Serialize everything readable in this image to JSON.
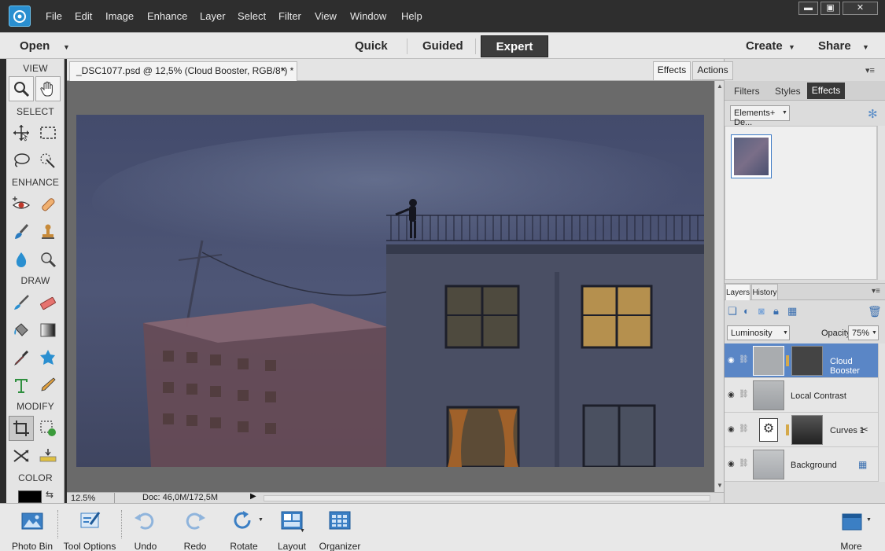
{
  "menubar": {
    "items": [
      "File",
      "Edit",
      "Image",
      "Enhance",
      "Layer",
      "Select",
      "Filter",
      "View",
      "Window",
      "Help"
    ],
    "window_controls": {
      "minimize": "▬",
      "maximize": "▣",
      "close": "✕"
    }
  },
  "modebar": {
    "open_label": "Open",
    "tabs": [
      "Quick",
      "Guided",
      "Expert"
    ],
    "active_tab": "Expert",
    "create_label": "Create",
    "share_label": "Share"
  },
  "toolbox": {
    "sections": [
      "VIEW",
      "SELECT",
      "ENHANCE",
      "DRAW",
      "MODIFY",
      "COLOR"
    ],
    "tools": {
      "view": [
        "zoom-icon",
        "hand-icon"
      ],
      "select": [
        "move-icon",
        "marquee-icon",
        "lasso-icon",
        "quick-selection-icon"
      ],
      "enhance": [
        "red-eye-icon",
        "spot-healing-icon",
        "smart-brush-icon",
        "clone-stamp-icon",
        "blur-icon",
        "sponge-icon"
      ],
      "draw": [
        "brush-icon",
        "eraser-icon",
        "paint-bucket-icon",
        "gradient-icon",
        "eyedropper-icon",
        "custom-shape-icon",
        "type-icon",
        "pencil-icon"
      ],
      "modify": [
        "crop-icon",
        "recompose-icon",
        "content-aware-move-icon",
        "straighten-icon"
      ]
    },
    "foreground_color": "#000000"
  },
  "document": {
    "tab_title": "_DSC1077.psd @ 12,5% (Cloud Booster, RGB/8*) *",
    "tab_close": "×",
    "zoom": "12.5%",
    "doc_size": "Doc: 46,0M/172,5M"
  },
  "right_panel": {
    "top_tabs": [
      "Effects",
      "Actions"
    ],
    "sub_tabs": [
      "Filters",
      "Styles",
      "Effects"
    ],
    "active_sub_tab": "Effects",
    "category_dropdown": "Elements+ De...",
    "layers_tabs": [
      "Layers",
      "History"
    ],
    "blend_mode": "Luminosity",
    "opacity_label": "Opacity:",
    "opacity_value": "75%",
    "layers": [
      {
        "name": "Cloud Booster",
        "selected": true
      },
      {
        "name": "Local Contrast",
        "selected": false
      },
      {
        "name": "Curves 1",
        "selected": false
      },
      {
        "name": "Background",
        "selected": false
      }
    ]
  },
  "bottombar": {
    "items": [
      "Photo Bin",
      "Tool Options",
      "Undo",
      "Redo",
      "Rotate",
      "Layout",
      "Organizer"
    ],
    "more_label": "More"
  },
  "colors": {
    "accent_blue": "#2a8fd0",
    "selected_layer": "#5a86c6",
    "sky": "#4a5272",
    "window_warm": "#b5904e"
  }
}
